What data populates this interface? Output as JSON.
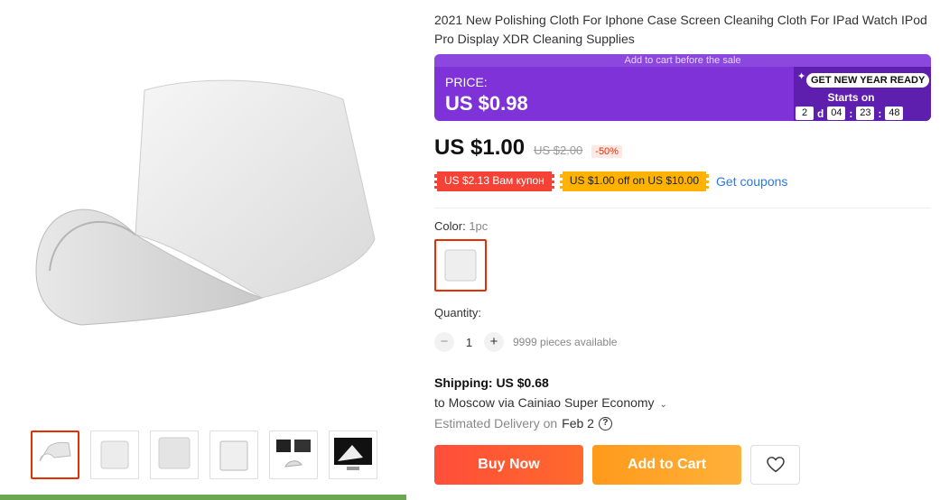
{
  "product": {
    "title": "2021 New Polishing Cloth For Iphone Case Screen Cleanihg Cloth For IPad Watch IPod Pro Display XDR Cleaning Supplies"
  },
  "sale_banner": {
    "top_note": "Add to cart before the sale",
    "price_label": "PRICE:",
    "price_value": "US $0.98",
    "badge": "GET NEW YEAR READY",
    "starts_label": "Starts on",
    "countdown": {
      "days": "2",
      "day_unit": "d",
      "hours": "04",
      "minutes": "23",
      "seconds": "48",
      "sep": ":"
    }
  },
  "pricing": {
    "current": "US $1.00",
    "original": "US $2.00",
    "discount": "-50%"
  },
  "coupons": {
    "coupon1": "US $2.13 Вам купон",
    "coupon2": "US $1.00 off on US $10.00",
    "get_coupons": "Get coupons"
  },
  "color": {
    "label": "Color:",
    "value": "1pc"
  },
  "quantity": {
    "label": "Quantity:",
    "minus": "−",
    "value": "1",
    "plus": "+",
    "available": "9999 pieces available"
  },
  "shipping": {
    "label": "Shipping:",
    "price": "US $0.68",
    "destination": "to Moscow via Cainiao Super Economy",
    "chevron": "⌄",
    "est_label": "Estimated Delivery on",
    "est_date": "Feb 2",
    "help": "?"
  },
  "actions": {
    "buy_now": "Buy Now",
    "add_to_cart": "Add to Cart"
  },
  "icons": {
    "wishlist": "heart-icon",
    "help": "question-circle-icon",
    "sparkle": "sparkle-icon"
  },
  "colors": {
    "banner_bg": "#7e32d8",
    "accent_red": "#e62e04",
    "link_blue": "#2a7ae2",
    "buy_now": "#ff4d3a",
    "add_to_cart": "#ff9a1a"
  }
}
